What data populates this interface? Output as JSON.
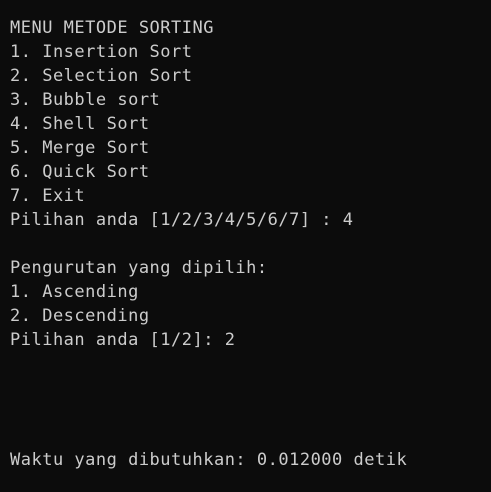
{
  "console": {
    "menu_title": "MENU METODE SORTING",
    "menu_items": [
      "1. Insertion Sort",
      "2. Selection Sort",
      "3. Bubble sort",
      "4. Shell Sort",
      "5. Merge Sort",
      "6. Quick Sort",
      "7. Exit"
    ],
    "menu_prompt": "Pilihan anda [1/2/3/4/5/6/7] : 4",
    "order_title": "Pengurutan yang dipilih:",
    "order_items": [
      "1. Ascending",
      "2. Descending"
    ],
    "order_prompt": "Pilihan anda [1/2]: 2",
    "elapsed_time": "Waktu yang dibutuhkan: 0.012000 detik"
  }
}
